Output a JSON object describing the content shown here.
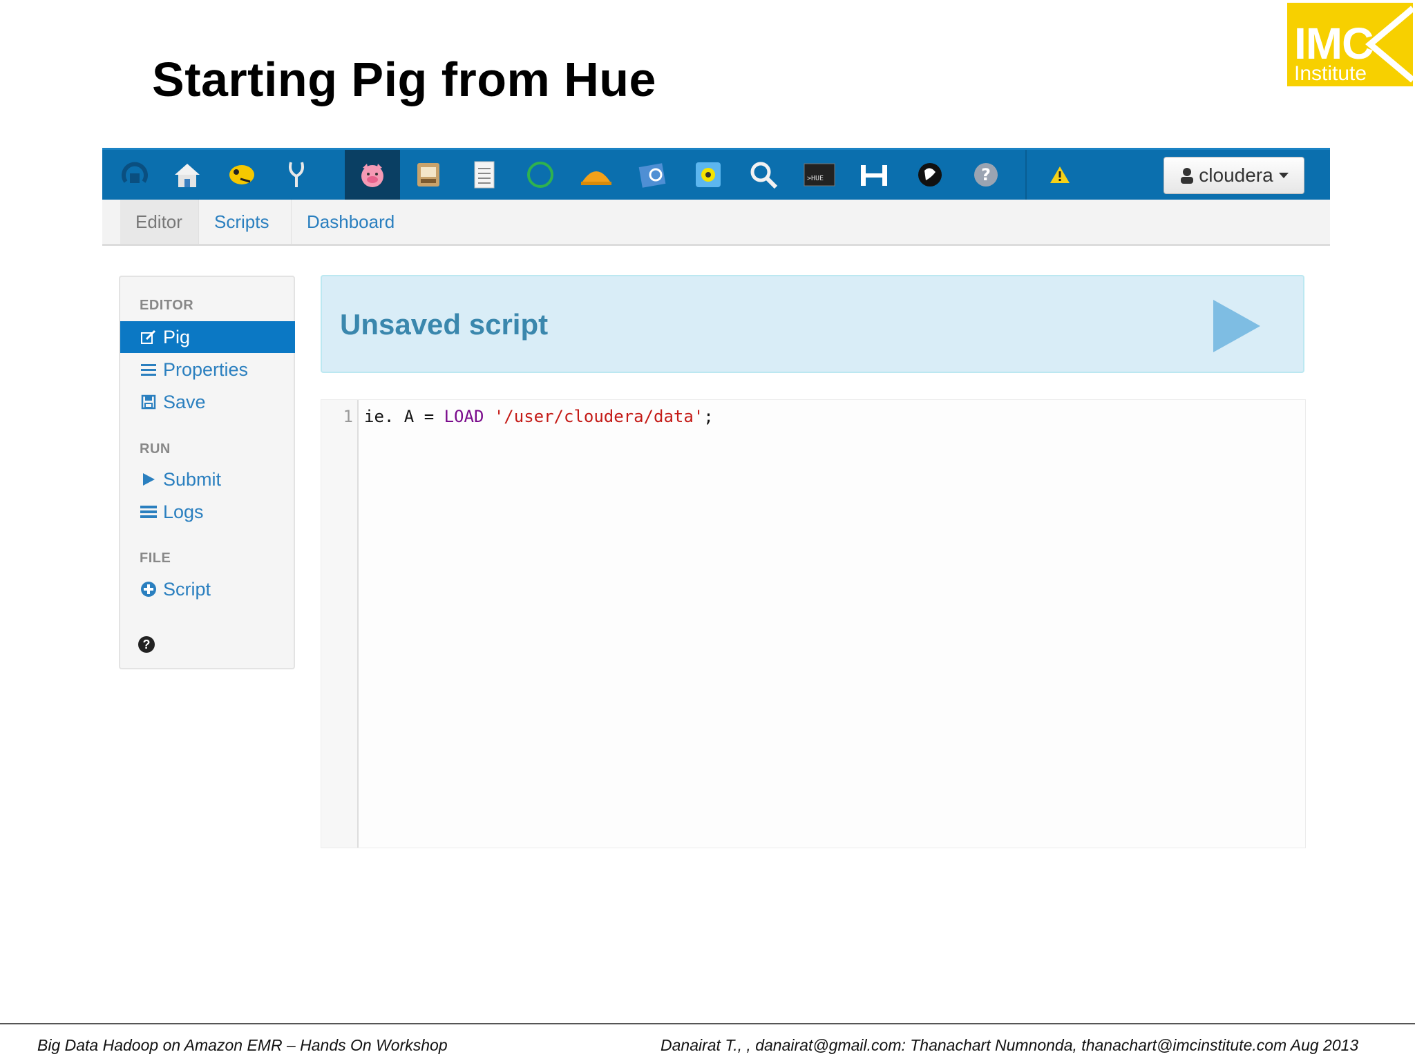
{
  "slide": {
    "title": "Starting Pig from Hue",
    "logo": {
      "line1": "IMC",
      "line2": "Institute"
    }
  },
  "navbar": {
    "icons": [
      "hue-logo-icon",
      "home-icon",
      "hive-icon",
      "impala-icon",
      "pig-icon",
      "file-browser-icon",
      "metastore-icon",
      "oozie-icon",
      "job-designer-icon",
      "file-browser-2-icon",
      "hbase-icon",
      "search-icon",
      "shell-icon",
      "hue-icon",
      "sqoop-icon",
      "help-icon",
      "warning-icon"
    ],
    "user_label": "cloudera"
  },
  "subnav": {
    "tabs": [
      "Editor",
      "Scripts",
      "Dashboard"
    ]
  },
  "sidebar": {
    "sections": [
      {
        "header": "EDITOR",
        "items": [
          {
            "label": "Pig",
            "icon": "edit-icon"
          },
          {
            "label": "Properties",
            "icon": "list-icon"
          },
          {
            "label": "Save",
            "icon": "save-icon"
          }
        ]
      },
      {
        "header": "RUN",
        "items": [
          {
            "label": "Submit",
            "icon": "play-icon"
          },
          {
            "label": "Logs",
            "icon": "logs-icon"
          }
        ]
      },
      {
        "header": "FILE",
        "items": [
          {
            "label": "Script",
            "icon": "plus-circle-icon"
          }
        ]
      }
    ]
  },
  "banner": {
    "title": "Unsaved script"
  },
  "editor": {
    "line_number": "1",
    "code_prefix": "ie. A = ",
    "code_keyword": "LOAD",
    "code_space": " ",
    "code_string": "'/user/cloudera/data'",
    "code_suffix": ";"
  },
  "footer": {
    "left": "Big Data Hadoop on Amazon EMR – Hands On Workshop",
    "right": "Danairat T., , danairat@gmail.com:  Thanachart Numnonda,  thanachart@imcinstitute.com   Aug 2013"
  },
  "colors": {
    "nav_bg": "#0b6fae",
    "nav_active": "#0a3f63",
    "accent": "#0b78c4",
    "banner_bg": "#d9edf7",
    "banner_text": "#3a87ad",
    "logo_bg": "#f7d000"
  }
}
